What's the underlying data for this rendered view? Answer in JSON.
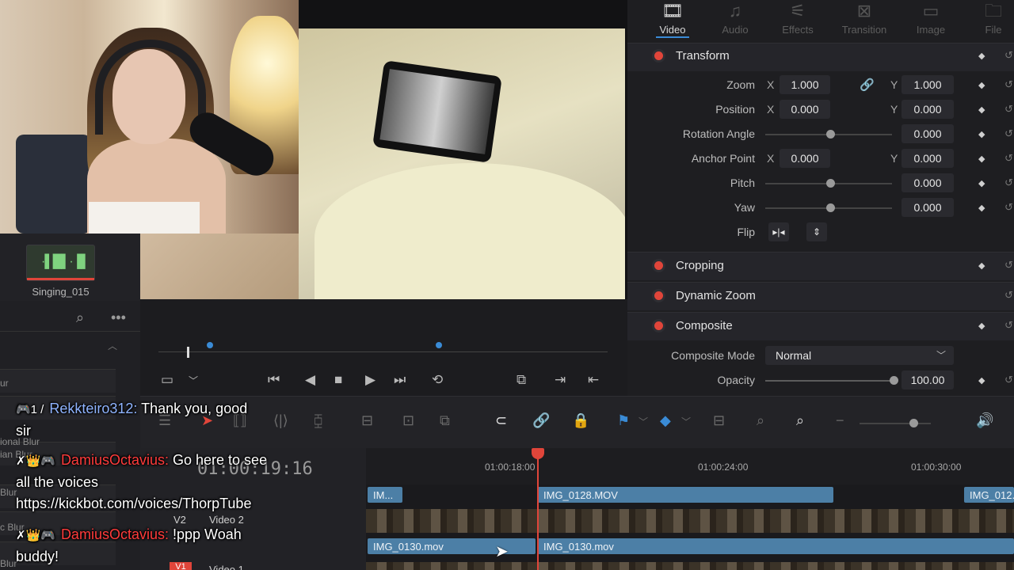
{
  "inspector": {
    "tabs": [
      {
        "label": "Video",
        "icon": "film-icon",
        "active": true
      },
      {
        "label": "Audio",
        "icon": "music-note-icon",
        "active": false
      },
      {
        "label": "Effects",
        "icon": "magic-wand-icon",
        "active": false
      },
      {
        "label": "Transition",
        "icon": "transition-icon",
        "active": false
      },
      {
        "label": "Image",
        "icon": "image-icon",
        "active": false
      },
      {
        "label": "File",
        "icon": "file-icon",
        "active": false
      }
    ],
    "transform": {
      "title": "Transform",
      "zoom": {
        "label": "Zoom",
        "x_axis": "X",
        "x": "1.000",
        "y_axis": "Y",
        "y": "1.000"
      },
      "position": {
        "label": "Position",
        "x_axis": "X",
        "x": "0.000",
        "y_axis": "Y",
        "y": "0.000"
      },
      "rotation": {
        "label": "Rotation Angle",
        "value": "0.000"
      },
      "anchor": {
        "label": "Anchor Point",
        "x_axis": "X",
        "x": "0.000",
        "y_axis": "Y",
        "y": "0.000"
      },
      "pitch": {
        "label": "Pitch",
        "value": "0.000"
      },
      "yaw": {
        "label": "Yaw",
        "value": "0.000"
      },
      "flip": {
        "label": "Flip"
      }
    },
    "cropping": {
      "title": "Cropping"
    },
    "dynamic_zoom": {
      "title": "Dynamic Zoom"
    },
    "composite": {
      "title": "Composite",
      "mode": {
        "label": "Composite Mode",
        "value": "Normal"
      },
      "opacity": {
        "label": "Opacity",
        "value": "100.00"
      }
    }
  },
  "media_bin": {
    "clip_name": "Singing_015"
  },
  "left_panel": {
    "rows": [
      "ional Blur",
      "ur",
      "ian Blur",
      "Blur",
      "c Blur",
      "al Blur",
      "Blur"
    ]
  },
  "timeline": {
    "timecode": "01:00:19:16",
    "ruler": [
      "01:00:18:00",
      "01:00:24:00",
      "01:00:30:00"
    ],
    "tracks": [
      {
        "id": "V2",
        "name": "Video 2"
      },
      {
        "id": "V1",
        "name": "Video 1"
      }
    ],
    "clips_v2": [
      "IM...",
      "IMG_0128.MOV",
      "IMG_012..."
    ],
    "clips_v1": [
      "IMG_0130.mov",
      "IMG_0130.mov"
    ]
  },
  "chat": [
    {
      "badges": "🎮1 /",
      "user": "Rekkteiro312:",
      "color": "blue",
      "lines": [
        "Thank you, good",
        "sir"
      ]
    },
    {
      "badges": "✗👑🎮",
      "user": "DamiusOctavius:",
      "color": "red",
      "lines": [
        "Go here to see",
        "all the voices",
        "https://kickbot.com/voices/ThorpTube"
      ]
    },
    {
      "badges": "✗👑🎮",
      "user": "DamiusOctavius:",
      "color": "red",
      "lines": [
        "!ppp Woah",
        "buddy!"
      ]
    }
  ]
}
